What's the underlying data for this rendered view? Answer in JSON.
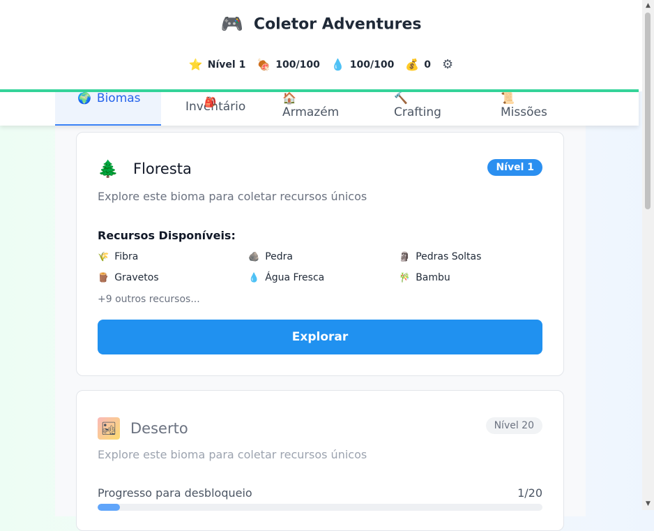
{
  "app": {
    "logo_icon": "🎮",
    "title": "Coletor Adventures"
  },
  "stats": [
    {
      "icon": "⭐",
      "name": "star-icon",
      "value": "Nível 1"
    },
    {
      "icon": "🍖",
      "name": "meat-icon",
      "value": "100/100"
    },
    {
      "icon": "💧",
      "name": "water-drop-icon",
      "value": "100/100"
    },
    {
      "icon": "💰",
      "name": "money-bag-icon",
      "value": "0"
    }
  ],
  "settings_icon": "⚙",
  "tabs": [
    {
      "icon": "🌍",
      "label": "Biomas",
      "active": true
    },
    {
      "icon": "🎒",
      "label": "Inventário"
    },
    {
      "icon": "🏠",
      "label": "Armazém"
    },
    {
      "icon": "🔨",
      "label": "Crafting"
    },
    {
      "icon": "📜",
      "label": "Missões"
    }
  ],
  "biomes": [
    {
      "icon": "🌲",
      "name": "Floresta",
      "level": "Nível 1",
      "description": "Explore este bioma para coletar recursos únicos",
      "resources_title": "Recursos Disponíveis:",
      "resources": [
        {
          "icon": "🌾",
          "name": "Fibra"
        },
        {
          "icon": "🪨",
          "name": "Pedra"
        },
        {
          "icon": "🗿",
          "name": "Pedras Soltas"
        },
        {
          "icon": "🪵",
          "name": "Gravetos"
        },
        {
          "icon": "💧",
          "name": "Água Fresca"
        },
        {
          "icon": "🎋",
          "name": "Bambu"
        }
      ],
      "more_resources": "+9 outros recursos...",
      "action": "Explorar"
    },
    {
      "icon": "🏜",
      "name": "Deserto",
      "level": "Nível 20",
      "description": "Explore este bioma para coletar recursos únicos",
      "progress_label": "Progresso para desbloqueio",
      "progress_count": "1/20",
      "progress_fraction": 0.05
    }
  ],
  "colors": {
    "accent": "#2091f0",
    "header_line": "#34d399",
    "active_tab": "#2563eb"
  }
}
